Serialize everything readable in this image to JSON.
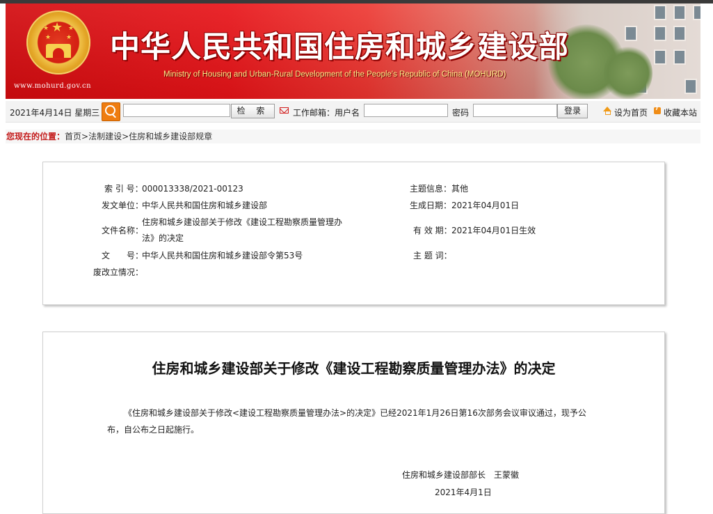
{
  "header": {
    "title": "中华人民共和国住房和城乡建设部",
    "subtitle": "Ministry of Housing and Urban-Rural Development of the People's Republic of China (MOHURD)",
    "site_url": "www.mohurd.gov.cn",
    "emblem": "national-emblem"
  },
  "toolbar": {
    "date": "2021年4月14日 星期三",
    "search_value": "",
    "search_button": "检 索",
    "mail_label": "工作邮箱：用户名",
    "username_value": "",
    "password_label": "密码",
    "password_value": "",
    "login_button": "登录",
    "set_home": "设为首页",
    "bookmark": "收藏本站"
  },
  "breadcrumb": {
    "lead": "您现在的位置：",
    "items": [
      "首页",
      "法制建设",
      "住房和城乡建设部规章"
    ],
    "separator": ">"
  },
  "meta": {
    "index_label": "索 引 号：",
    "index_value": "000013338/2021-00123",
    "topic_label": "主题信息：",
    "topic_value": "其他",
    "issuer_label": "发文单位：",
    "issuer_value": "中华人民共和国住房和城乡建设部",
    "date_label": "生成日期：",
    "date_value": "2021年04月01日",
    "filename_label": "文件名称：",
    "filename_value_1": "住房和城乡建设部关于修改《建设工程勘察质量管理办",
    "filename_value_2": "法》的决定",
    "valid_label": "有 效 期：",
    "valid_value": "2021年04月01日生效",
    "docno_label": "文　　号：",
    "docno_value": "中华人民共和国住房和城乡建设部令第53号",
    "keywords_label": "主 题 词：",
    "keywords_value": "",
    "status_label": "废改立情况：",
    "status_value": ""
  },
  "document": {
    "title": "住房和城乡建设部关于修改《建设工程勘察质量管理办法》的决定",
    "paragraph": "《住房和城乡建设部关于修改<建设工程勘察质量管理办法>的决定》已经2021年1月26日第16次部务会议审议通过，现予公布，自公布之日起施行。",
    "signature": "住房和城乡建设部部长　王蒙徽",
    "date": "2021年4月1日"
  },
  "colors": {
    "banner_red": "#e8151a",
    "title_text": "#ffffff",
    "subtitle_text": "#ffef8a",
    "breadcrumb_lead": "#c31a1a",
    "search_icon_bg": "#ef7d10"
  }
}
